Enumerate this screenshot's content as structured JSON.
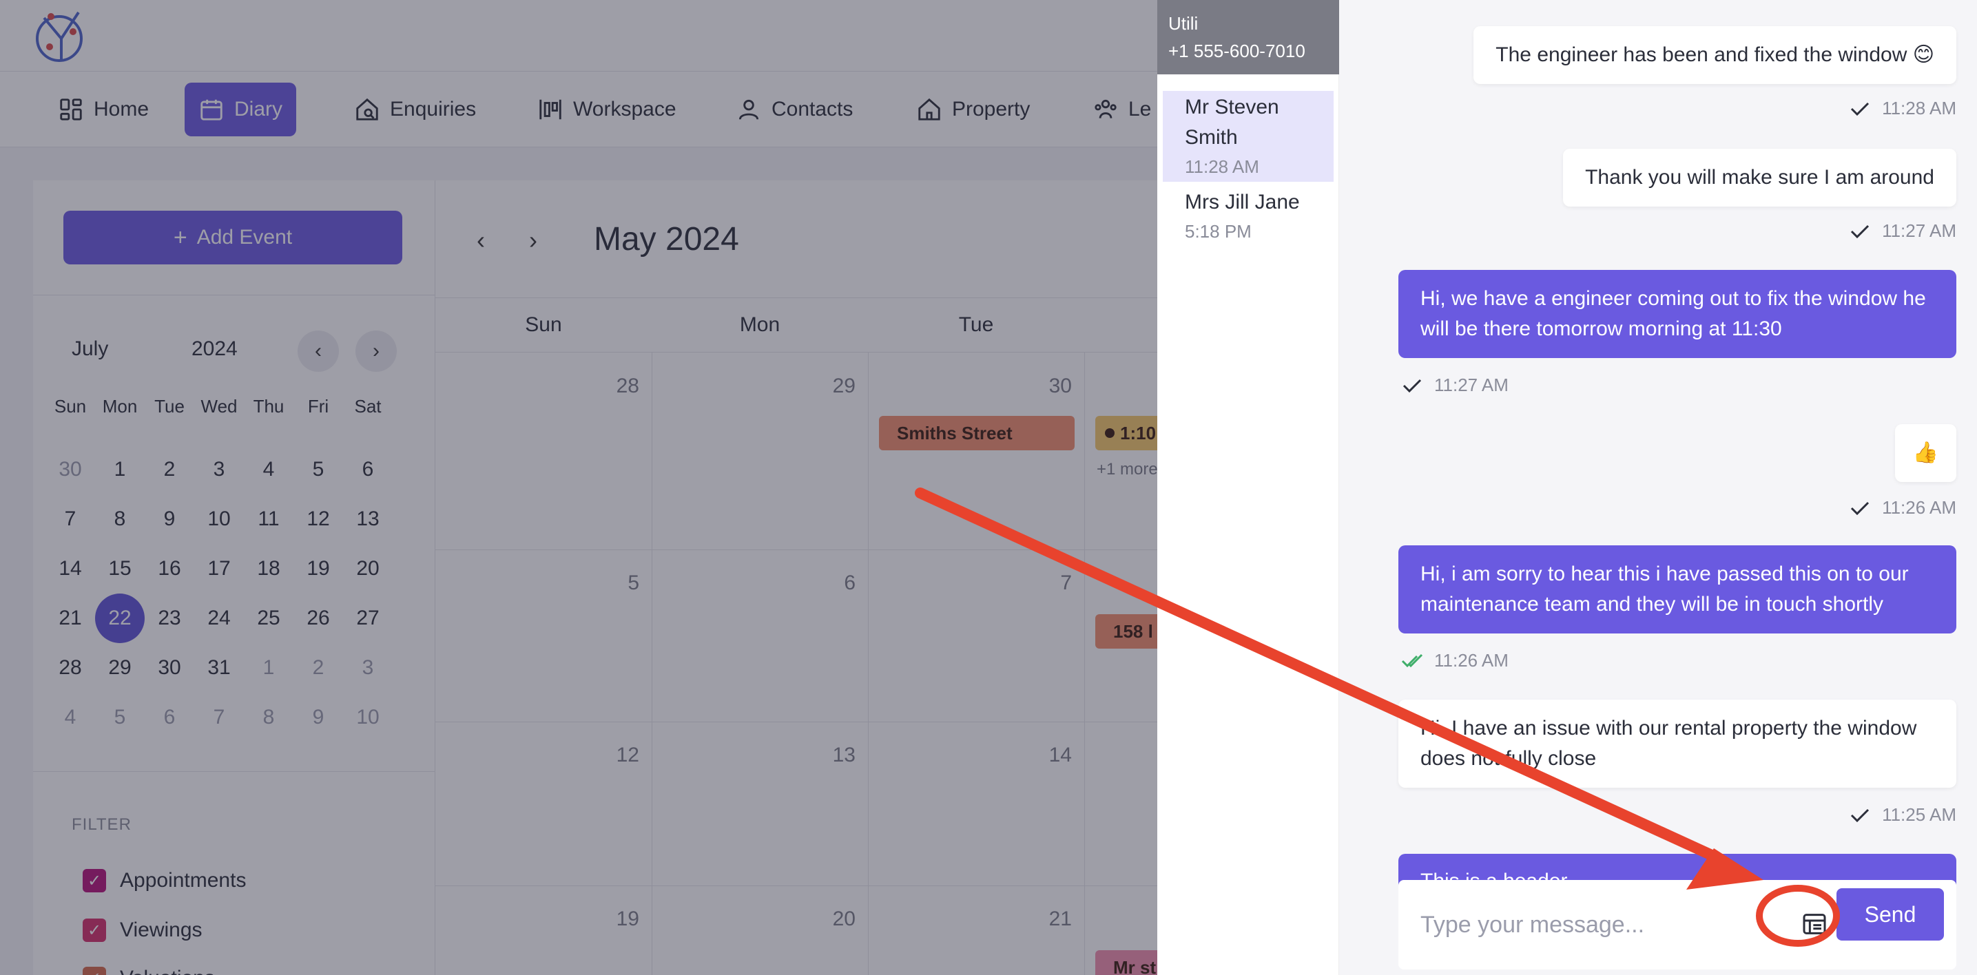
{
  "nav": {
    "items": [
      {
        "label": "Home",
        "icon": "grid-icon"
      },
      {
        "label": "Diary",
        "icon": "calendar-icon",
        "active": true
      },
      {
        "label": "Enquiries",
        "icon": "home-search-icon"
      },
      {
        "label": "Workspace",
        "icon": "workspace-icon"
      },
      {
        "label": "Contacts",
        "icon": "person-icon"
      },
      {
        "label": "Property",
        "icon": "house-icon"
      },
      {
        "label": "Le",
        "icon": "people-icon"
      }
    ]
  },
  "diary": {
    "add_event": "Add Event",
    "mini_calendar": {
      "month": "July",
      "year": "2024",
      "weekdays": [
        "Sun",
        "Mon",
        "Tue",
        "Wed",
        "Thu",
        "Fri",
        "Sat"
      ],
      "weeks": [
        [
          "30",
          "1",
          "2",
          "3",
          "4",
          "5",
          "6"
        ],
        [
          "7",
          "8",
          "9",
          "10",
          "11",
          "12",
          "13"
        ],
        [
          "14",
          "15",
          "16",
          "17",
          "18",
          "19",
          "20"
        ],
        [
          "21",
          "22",
          "23",
          "24",
          "25",
          "26",
          "27"
        ],
        [
          "28",
          "29",
          "30",
          "31",
          "1",
          "2",
          "3"
        ],
        [
          "4",
          "5",
          "6",
          "7",
          "8",
          "9",
          "10"
        ]
      ],
      "selected": "22"
    },
    "filter": {
      "title": "FILTER",
      "items": [
        {
          "label": "Appointments",
          "color": "#b5127a"
        },
        {
          "label": "Viewings",
          "color": "#d32f6a"
        },
        {
          "label": "Valuations",
          "color": "#d4684a"
        }
      ]
    },
    "calendar": {
      "title": "May 2024",
      "weekdays": [
        "Sun",
        "Mon",
        "Tue"
      ],
      "rows": [
        [
          "28",
          "29",
          "30"
        ],
        [
          "5",
          "6",
          "7"
        ],
        [
          "12",
          "13",
          "14"
        ],
        [
          "19",
          "20",
          "21"
        ]
      ],
      "events": {
        "smiths": "Smiths Street",
        "time": "1:10",
        "more": "+1 more",
        "e158": "158 l",
        "mrst": "Mr st"
      }
    }
  },
  "contacts": {
    "header_name": "Utili",
    "header_phone": "+1 555-600-7010",
    "list": [
      {
        "name": "Mr Steven Smith",
        "time": "11:28 AM"
      },
      {
        "name": "Mrs Jill Jane",
        "time": "5:18 PM"
      }
    ]
  },
  "chat": {
    "messages": [
      {
        "text": "The engineer has been and fixed the window 😊",
        "time": "11:28 AM"
      },
      {
        "text": "Thank you will make sure I am around",
        "time": "11:27 AM"
      },
      {
        "text": "Hi, we have a engineer coming out to fix the window he will be there tomorrow morning at 11:30",
        "time": "11:27 AM"
      },
      {
        "text": "👍",
        "time": "11:26 AM"
      },
      {
        "text": "Hi, i am sorry to hear this i have passed this on to our maintenance team and they will be in touch shortly",
        "time": "11:26 AM"
      },
      {
        "text": "Hi, I have an issue with our rental property the window does not fully close",
        "time": "11:25 AM"
      },
      {
        "text": "This is a header"
      }
    ],
    "input_placeholder": "Type your message...",
    "send_label": "Send"
  },
  "colors": {
    "accent": "#6a5ae0",
    "annotation": "#e8432d",
    "read_check": "#3fae6a"
  }
}
